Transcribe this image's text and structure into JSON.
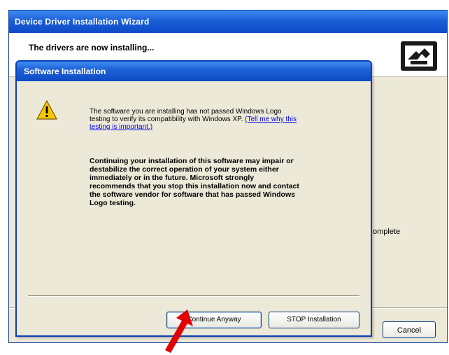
{
  "wizard": {
    "title": "Device Driver Installation Wizard",
    "header_text": "The drivers are now installing...",
    "partial_complete_text": "omplete",
    "cancel_label": "Cancel"
  },
  "dialog": {
    "title": "Software Installation",
    "message_part1": "The software you are installing has not passed Windows Logo testing to verify its compatibility with Windows XP. ",
    "link_text": "(Tell me why this testing is important.)",
    "message_bold": "Continuing your installation of this software may impair or destabilize the correct operation of your system either immediately or in the future. Microsoft strongly recommends that you stop this installation now and contact the software vendor for software that has passed Windows Logo testing.",
    "continue_label": "Continue Anyway",
    "stop_label": "STOP Installation"
  },
  "colors": {
    "titlebar": "#0d49c6",
    "window_bg": "#ece9d8",
    "arrow": "#e00000",
    "warning_yellow": "#f6c800"
  },
  "icons": {
    "warning": "warning-icon",
    "wizard": "driver-install-icon",
    "arrow": "annotation-arrow"
  }
}
